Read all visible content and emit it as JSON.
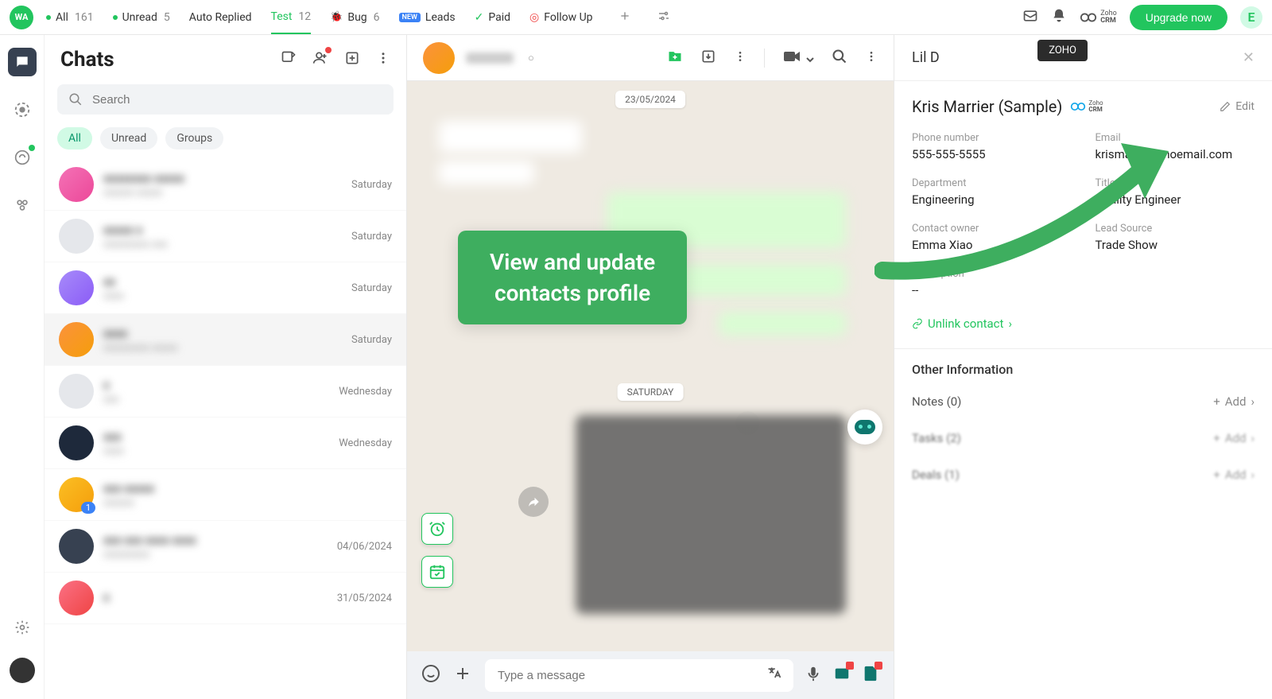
{
  "topbar": {
    "tabs": [
      {
        "label": "All",
        "count": "161",
        "dot": true
      },
      {
        "label": "Unread",
        "count": "5",
        "dot": true
      },
      {
        "label": "Auto Replied",
        "count": ""
      },
      {
        "label": "Test",
        "count": "12",
        "active": true
      },
      {
        "label": "Bug",
        "count": "6",
        "icon": "bug"
      },
      {
        "label": "Leads",
        "count": "",
        "icon": "leads"
      },
      {
        "label": "Paid",
        "count": "",
        "icon": "paid"
      },
      {
        "label": "Follow Up",
        "count": "",
        "icon": "followup"
      }
    ],
    "upgrade": "Upgrade now",
    "avatar_initial": "E",
    "crm_label": "Zoho CRM",
    "tooltip": "ZOHO"
  },
  "chats": {
    "title": "Chats",
    "search_placeholder": "Search",
    "filters": [
      "All",
      "Unread",
      "Groups"
    ],
    "active_filter": "All",
    "items": [
      {
        "time": "Saturday"
      },
      {
        "time": "Saturday"
      },
      {
        "time": "Saturday"
      },
      {
        "time": "Saturday",
        "selected": true
      },
      {
        "time": "Wednesday"
      },
      {
        "time": "Wednesday"
      },
      {
        "time": "",
        "unread": "1"
      },
      {
        "time": "04/06/2024"
      },
      {
        "time": "31/05/2024"
      }
    ]
  },
  "conversation": {
    "date1": "23/05/2024",
    "date2": "SATURDAY",
    "input_placeholder": "Type a message"
  },
  "detail": {
    "short_name": "Lil D",
    "contact_name": "Kris Marrier (Sample)",
    "edit": "Edit",
    "fields": {
      "phone_label": "Phone number",
      "phone_value": "555-555-5555",
      "email_label": "Email",
      "email_value": "krismarrier@noemail.com",
      "dept_label": "Department",
      "dept_value": "Engineering",
      "title_label": "Title",
      "title_value": "Quality Engineer",
      "owner_label": "Contact owner",
      "owner_value": "Emma Xiao",
      "source_label": "Lead Source",
      "source_value": "Trade Show",
      "desc_label": "Description",
      "desc_value": "--"
    },
    "unlink": "Unlink contact",
    "other_info": "Other Information",
    "sections": [
      {
        "label": "Notes (0)",
        "action": "Add"
      },
      {
        "label": "Tasks (2)",
        "action": "Add"
      },
      {
        "label": "Deals (1)",
        "action": "Add"
      }
    ]
  },
  "callout": {
    "line1": "View and update",
    "line2": "contacts profile"
  }
}
